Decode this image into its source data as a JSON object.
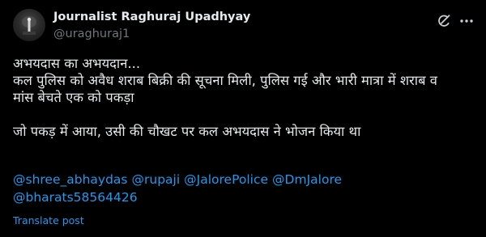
{
  "author": {
    "name": "Journalist Raghuraj Upadhyay",
    "handle": "@uraghuraj1"
  },
  "tweet": {
    "lines_block1": [
      "अभयदास का अभयदान...",
      "कल पुलिस को अवैध शराब बिक्री की सूचना मिली, पुलिस गई और भारी मात्रा में शराब व",
      "मांस बेचते एक को पकड़ा"
    ],
    "line_block2": "जो पकड़ में आया, उसी की चौखट पर कल अभयदास ने भोजन किया था",
    "mentions": [
      "@shree_abhaydas",
      "@rupaji",
      "@JalorePolice",
      "@DmJalore",
      "@bharats58564426"
    ]
  },
  "actions": {
    "translate_label": "Translate post"
  },
  "icons": {
    "grok": "grok-icon",
    "more": "more-options-icon"
  },
  "colors": {
    "background": "#000000",
    "text": "#e7e9ea",
    "secondary": "#71767b",
    "link": "#1d9bf0"
  }
}
